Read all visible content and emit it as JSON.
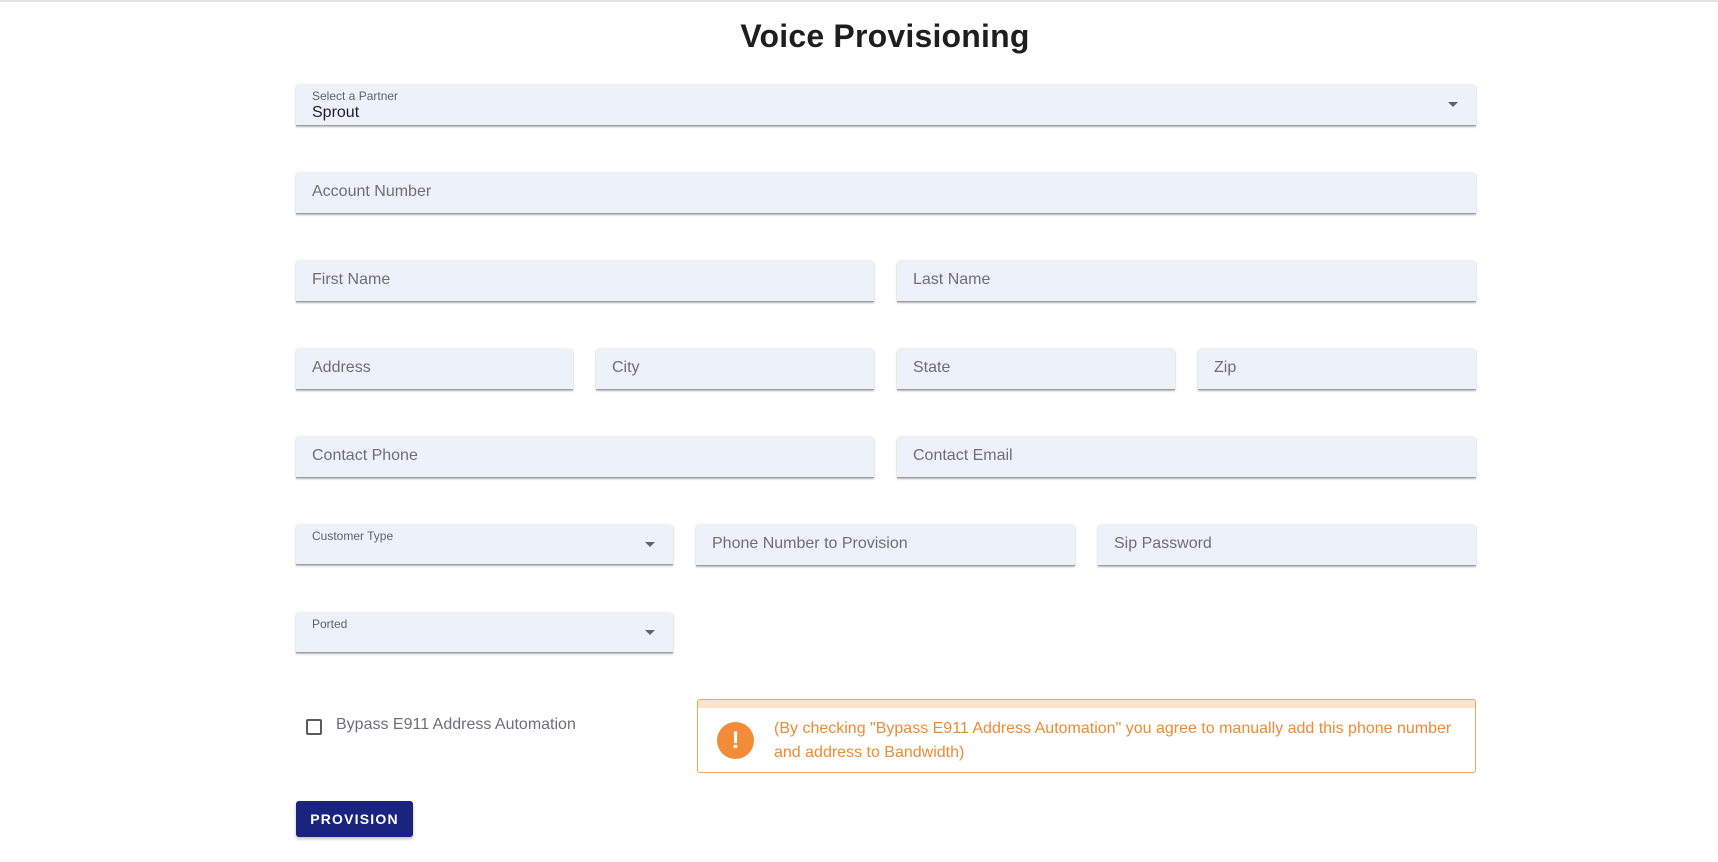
{
  "title": "Voice Provisioning",
  "partner": {
    "label": "Select a Partner",
    "value": "Sprout"
  },
  "fields": {
    "account_number": "Account Number",
    "first_name": "First Name",
    "last_name": "Last Name",
    "address": "Address",
    "city": "City",
    "state": "State",
    "zip": "Zip",
    "contact_phone": "Contact Phone",
    "contact_email": "Contact Email",
    "customer_type": "Customer Type",
    "phone_number": "Phone Number to Provision",
    "sip_password": "Sip Password",
    "ported": "Ported"
  },
  "bypass": {
    "label": "Bypass E911 Address Automation",
    "checked": false
  },
  "alert": {
    "icon": "exclamation-icon",
    "symbol": "!",
    "message": "(By checking \"Bypass E911 Address Automation\" you agree to manually add this phone number and address to Bandwidth)",
    "color": "#f28c38"
  },
  "button": {
    "label": "PROVISION",
    "color": "#1a237e"
  }
}
